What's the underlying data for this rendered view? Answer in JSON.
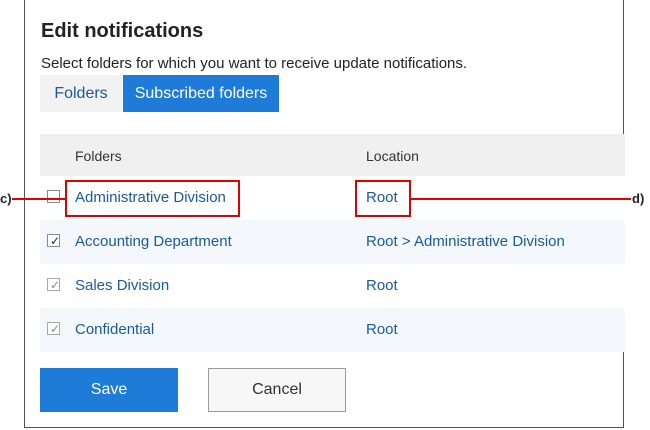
{
  "dialog": {
    "title": "Edit notifications",
    "description": "Select folders for which you want to receive update notifications."
  },
  "tabs": [
    {
      "label": "Folders",
      "active": false
    },
    {
      "label": "Subscribed folders",
      "active": true
    }
  ],
  "table": {
    "headers": {
      "folders": "Folders",
      "location": "Location"
    },
    "rows": [
      {
        "folder": "Administrative Division",
        "location": "Root",
        "checked": false
      },
      {
        "folder": "Accounting Department",
        "location": "Root > Administrative Division",
        "checked": true
      },
      {
        "folder": "Sales Division",
        "location": "Root",
        "checked": true
      },
      {
        "folder": "Confidential",
        "location": "Root",
        "checked": true
      }
    ]
  },
  "buttons": {
    "save": "Save",
    "cancel": "Cancel"
  },
  "annotations": {
    "c": "c)",
    "d": "d)"
  },
  "colors": {
    "primary": "#1e7bd8",
    "link": "#1a5a9a",
    "highlight": "#e00000"
  },
  "check_mark": "✓"
}
